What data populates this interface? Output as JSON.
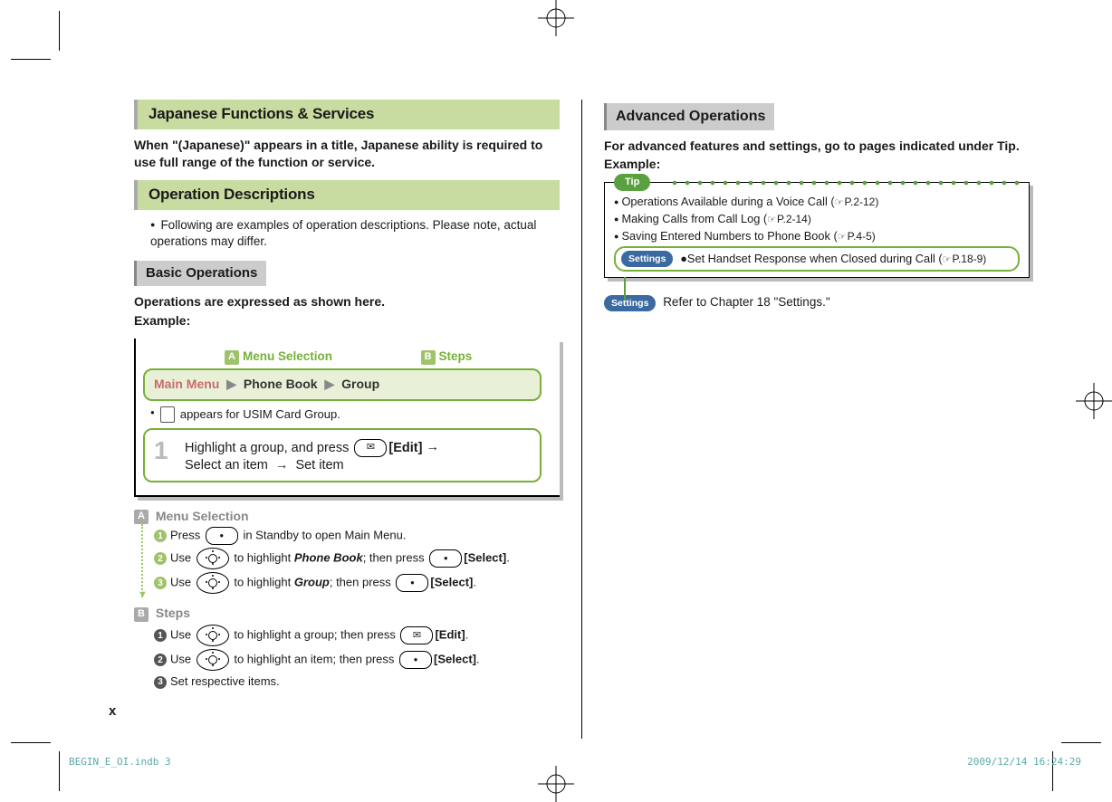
{
  "left": {
    "title1": "Japanese Functions & Services",
    "desc1": "When \"(Japanese)\" appears in a title, Japanese ability is required to use full range of the function or service.",
    "title2": "Operation Descriptions",
    "bullet2": "Following are examples of operation descriptions. Please note, actual operations may differ.",
    "title3": "Basic Operations",
    "desc3a": "Operations are expressed as shown here.",
    "desc3b": "Example:",
    "labelA": "Menu Selection",
    "labelB": "Steps",
    "menu1": "Main Menu",
    "menu2": "Phone Book",
    "menu3": "Group",
    "usim_note": " appears for USIM Card Group.",
    "step1a": "Highlight a group, and press ",
    "step1_key": "[Edit]",
    "step1b": "Select an item ",
    "step1c": " Set item",
    "subA": "Menu Selection",
    "subA1a": "Press ",
    "subA1b": " in Standby to open Main Menu.",
    "subA2a": "Use ",
    "subA2b": " to highlight ",
    "subA2c": "Phone Book",
    "subA2d": "; then press ",
    "subA2e": "[Select]",
    "subA2f": ".",
    "subA3a": "Use ",
    "subA3b": " to highlight ",
    "subA3c": "Group",
    "subA3d": "; then press ",
    "subA3e": "[Select]",
    "subA3f": ".",
    "subB": "Steps",
    "subB1a": "Use ",
    "subB1b": " to highlight a group; then press ",
    "subB1c": "[Edit]",
    "subB1d": ".",
    "subB2a": "Use ",
    "subB2b": " to highlight an item; then press ",
    "subB2c": "[Select]",
    "subB2d": ".",
    "subB3": "Set respective items."
  },
  "right": {
    "title": "Advanced Operations",
    "desc1": "For advanced features and settings, go to pages indicated under Tip.",
    "desc2": "Example:",
    "tip_label": "Tip",
    "tip1a": "Operations Available during a Voice Call (",
    "tip1b": "P.2-12)",
    "tip2a": "Making Calls from Call Log (",
    "tip2b": "P.2-14)",
    "tip3a": "Saving Entered Numbers to Phone Book (",
    "tip3b": "P.4-5)",
    "settings_label": "Settings",
    "tip4a": "Set Handset Response when Closed during Call (",
    "tip4b": "P.18-9)",
    "settings_note": "Refer to Chapter 18 \"Settings.\""
  },
  "page_num": "x",
  "footer_left": "BEGIN_E_OI.indb   3",
  "footer_right": "2009/12/14   16:24:29"
}
